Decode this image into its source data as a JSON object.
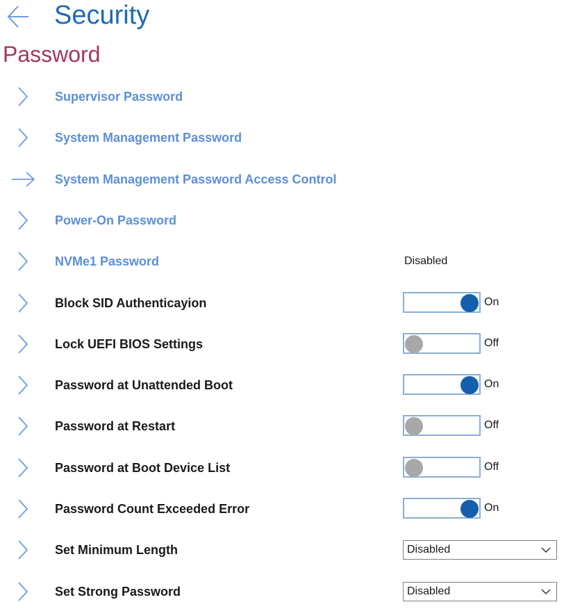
{
  "header": {
    "title": "Security",
    "back_icon": "arrow-left-icon"
  },
  "section": {
    "title": "Password"
  },
  "colors": {
    "title": "#1f6ab3",
    "section": "#a3365f",
    "link": "#5b8fd8",
    "toggle_on": "#1560ad",
    "toggle_off": "#a8a8a8"
  },
  "rows": [
    {
      "label": "Supervisor Password",
      "type": "link",
      "icon": "chevron-right-icon"
    },
    {
      "label": "System Management Password",
      "type": "link",
      "icon": "chevron-right-icon"
    },
    {
      "label": "System Management Password Access Control",
      "type": "link",
      "icon": "arrow-right-icon"
    },
    {
      "label": "Power-On Password",
      "type": "link",
      "icon": "chevron-right-icon"
    },
    {
      "label": "NVMe1 Password",
      "type": "link",
      "icon": "chevron-right-icon",
      "status": "Disabled"
    },
    {
      "label": "Block SID Authenticayion",
      "type": "toggle",
      "icon": "chevron-right-icon",
      "state": "on",
      "state_label": "On"
    },
    {
      "label": "Lock UEFI BIOS Settings",
      "type": "toggle",
      "icon": "chevron-right-icon",
      "state": "off",
      "state_label": "Off"
    },
    {
      "label": "Password at Unattended Boot",
      "type": "toggle",
      "icon": "chevron-right-icon",
      "state": "on",
      "state_label": "On"
    },
    {
      "label": "Password at Restart",
      "type": "toggle",
      "icon": "chevron-right-icon",
      "state": "off",
      "state_label": "Off"
    },
    {
      "label": "Password at Boot Device List",
      "type": "toggle",
      "icon": "chevron-right-icon",
      "state": "off",
      "state_label": "Off"
    },
    {
      "label": "Password Count Exceeded Error",
      "type": "toggle",
      "icon": "chevron-right-icon",
      "state": "on",
      "state_label": "On"
    },
    {
      "label": "Set Minimum Length",
      "type": "select",
      "icon": "chevron-right-icon",
      "value": "Disabled"
    },
    {
      "label": "Set Strong Password",
      "type": "select",
      "icon": "chevron-right-icon",
      "value": "Disabled"
    }
  ]
}
